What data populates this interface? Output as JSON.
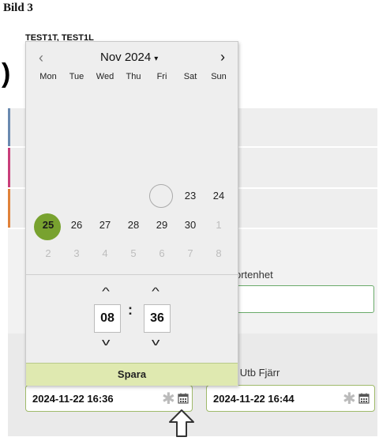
{
  "page": {
    "heading": "Bild 3",
    "user_label": "TEST1T, TEST1L"
  },
  "background": {
    "row_accent_colors": [
      "#6a8ab0",
      "#c93f7a",
      "#e0823a"
    ],
    "fragment_field_label": "ortenhet",
    "destination_field_label": "st Utb Fjärr",
    "start_datetime_value": "2024-11-22 16:36",
    "end_datetime_value": "2024-11-22 16:44",
    "clear_icon_glyph": "✱"
  },
  "calendar": {
    "month_label": "Nov 2024",
    "month_caret": "▾",
    "prev_glyph": "‹",
    "next_glyph": "›",
    "weekdays": [
      "Mon",
      "Tue",
      "Wed",
      "Thu",
      "Fri",
      "Sat",
      "Sun"
    ],
    "weeks": [
      [
        {
          "label": "",
          "type": "empty"
        },
        {
          "label": "",
          "type": "empty"
        },
        {
          "label": "",
          "type": "empty"
        },
        {
          "label": "",
          "type": "empty"
        },
        {
          "label": "",
          "type": "empty"
        },
        {
          "label": "",
          "type": "empty"
        },
        {
          "label": "",
          "type": "empty"
        }
      ],
      [
        {
          "label": "",
          "type": "empty"
        },
        {
          "label": "",
          "type": "empty"
        },
        {
          "label": "",
          "type": "empty"
        },
        {
          "label": "",
          "type": "empty"
        },
        {
          "label": "",
          "type": "empty"
        },
        {
          "label": "",
          "type": "empty"
        },
        {
          "label": "",
          "type": "empty"
        }
      ],
      [
        {
          "label": "",
          "type": "empty"
        },
        {
          "label": "",
          "type": "empty"
        },
        {
          "label": "",
          "type": "empty"
        },
        {
          "label": "",
          "type": "empty"
        },
        {
          "label": "",
          "type": "empty"
        },
        {
          "label": "",
          "type": "empty"
        },
        {
          "label": "",
          "type": "empty"
        }
      ],
      [
        {
          "label": "",
          "type": "empty"
        },
        {
          "label": "",
          "type": "empty"
        },
        {
          "label": "",
          "type": "empty"
        },
        {
          "label": "",
          "type": "empty"
        },
        {
          "label": "",
          "type": "today"
        },
        {
          "label": "23",
          "type": "normal"
        },
        {
          "label": "24",
          "type": "normal"
        }
      ],
      [
        {
          "label": "25",
          "type": "selected"
        },
        {
          "label": "26",
          "type": "normal"
        },
        {
          "label": "27",
          "type": "normal"
        },
        {
          "label": "28",
          "type": "normal"
        },
        {
          "label": "29",
          "type": "normal"
        },
        {
          "label": "30",
          "type": "normal"
        },
        {
          "label": "1",
          "type": "other"
        }
      ],
      [
        {
          "label": "2",
          "type": "other"
        },
        {
          "label": "3",
          "type": "other"
        },
        {
          "label": "4",
          "type": "other"
        },
        {
          "label": "5",
          "type": "other"
        },
        {
          "label": "6",
          "type": "other"
        },
        {
          "label": "7",
          "type": "other"
        },
        {
          "label": "8",
          "type": "other"
        }
      ]
    ],
    "selected_color": "#78a22f",
    "time": {
      "hours": "08",
      "minutes": "36",
      "separator": ":",
      "up_glyph": "^",
      "down_glyph": "v"
    },
    "save_label": "Spara"
  }
}
